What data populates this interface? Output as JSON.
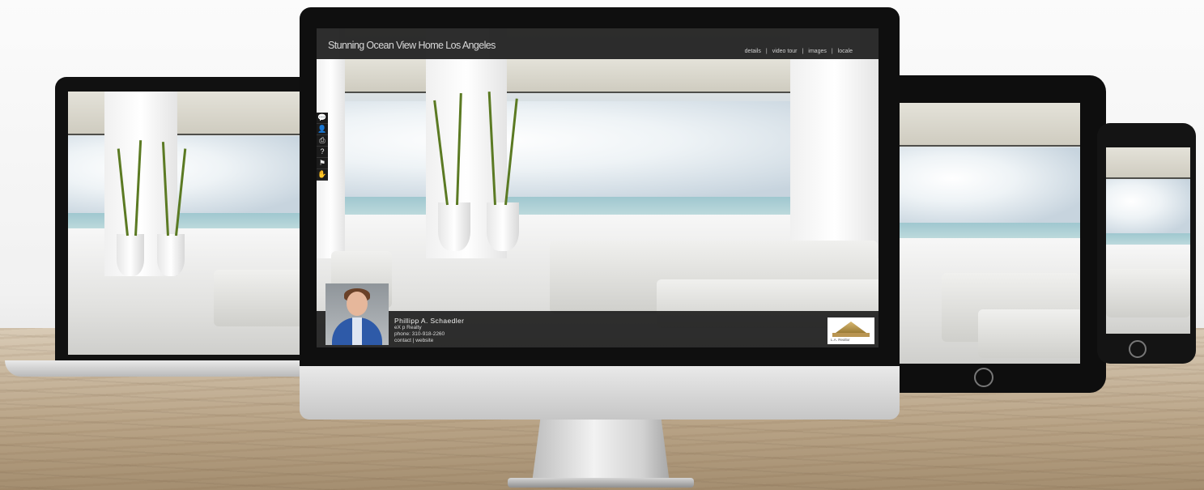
{
  "listing": {
    "title": "Stunning Ocean View Home Los Angeles"
  },
  "nav": {
    "items": [
      "details",
      "video tour",
      "images",
      "locale"
    ],
    "separator": "|"
  },
  "toolbar": {
    "icons": [
      "speech-bubble-icon",
      "contact-card-icon",
      "printer-icon",
      "question-icon",
      "flag-icon",
      "hand-icon"
    ],
    "glyphs": [
      "💬",
      "👤",
      "⎙",
      "?",
      "⚑",
      "✋"
    ]
  },
  "agent": {
    "name": "Phillipp A. Schaedler",
    "company": "eX p Realty",
    "phone": "phone: 310-918-2260",
    "links": "contact | website"
  },
  "logo": {
    "text": "L.A. Realtor"
  },
  "colors": {
    "header_bg": "#202020",
    "footer_bg": "#161616",
    "sea": "#9fc7cf",
    "plant": "#5b7a23"
  }
}
